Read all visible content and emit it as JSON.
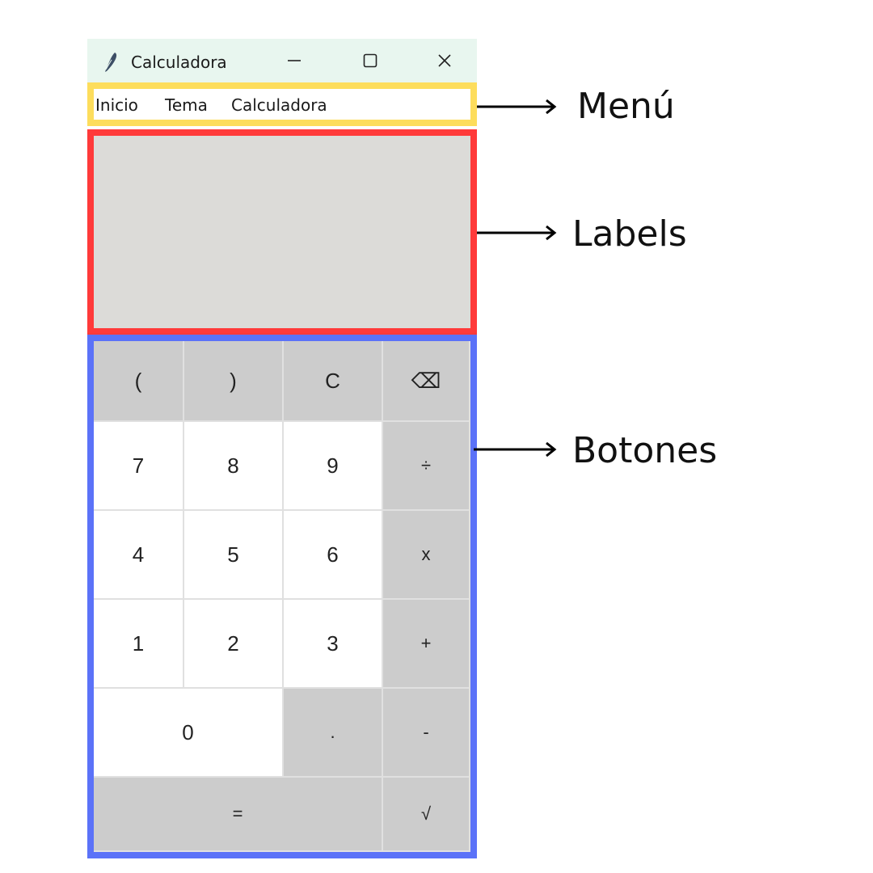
{
  "window": {
    "title": "Calculadora",
    "app_icon": "feather-icon",
    "controls": [
      "minimize-icon",
      "maximize-icon",
      "close-icon"
    ]
  },
  "menu": {
    "items": [
      "Inicio",
      "Tema",
      "Calculadora"
    ]
  },
  "display": {
    "value": ""
  },
  "buttons": {
    "row1": [
      "(",
      ")",
      "C",
      "⌫"
    ],
    "row2": [
      "7",
      "8",
      "9",
      "÷"
    ],
    "row3": [
      "4",
      "5",
      "6",
      "x"
    ],
    "row4": [
      "1",
      "2",
      "3",
      "+"
    ],
    "row5": [
      "0",
      ".",
      "-"
    ],
    "row6": [
      "=",
      "√"
    ]
  },
  "annotations": {
    "menu": "Menú",
    "labels": "Labels",
    "buttons": "Botones"
  },
  "colors": {
    "menu_highlight": "#fddd5c",
    "labels_highlight": "#ff3a3a",
    "buttons_highlight": "#5b72f8",
    "titlebar_bg": "#e8f6ef",
    "display_bg": "#dcdbd8",
    "operator_button_bg": "#cccccc",
    "digit_button_bg": "#ffffff"
  }
}
